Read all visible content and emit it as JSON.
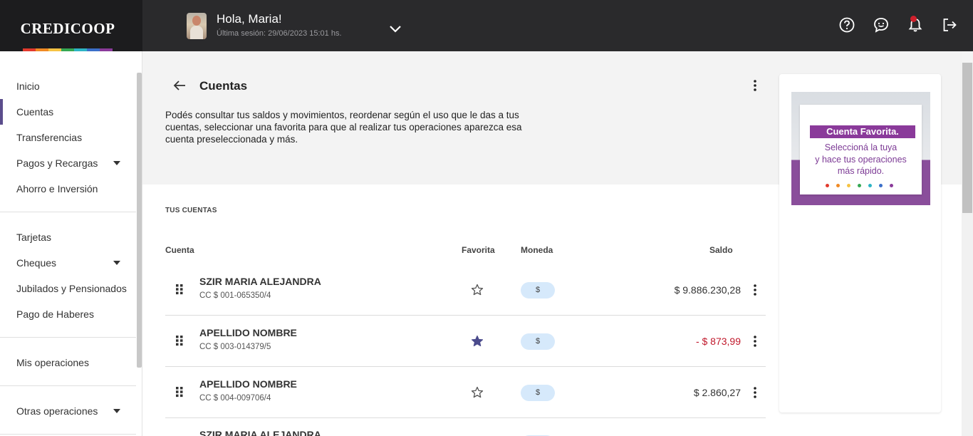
{
  "brand": {
    "name": "CREDICOOP",
    "stripe_colors": [
      "#e23a2d",
      "#f08a24",
      "#f6c343",
      "#35a853",
      "#2db4c5",
      "#3b6fc9",
      "#8a3a9a"
    ]
  },
  "user": {
    "greeting": "Hola, Maria!",
    "last_session": "Última sesión: 29/06/2023 15:01 hs."
  },
  "top_icons": [
    "help-icon",
    "chat-icon",
    "bell-icon",
    "logout-icon"
  ],
  "sidebar": {
    "items": [
      {
        "label": "Inicio"
      },
      {
        "label": "Cuentas",
        "active": true
      },
      {
        "label": "Transferencias"
      },
      {
        "label": "Pagos y Recargas",
        "expandable": true
      },
      {
        "label": "Ahorro e Inversión"
      },
      {
        "label": "Tarjetas"
      },
      {
        "label": "Cheques",
        "expandable": true
      },
      {
        "label": "Jubilados y Pensionados"
      },
      {
        "label": "Pago de Haberes"
      },
      {
        "label": "Mis operaciones"
      },
      {
        "label": "Otras operaciones",
        "expandable": true
      }
    ]
  },
  "page": {
    "title": "Cuentas",
    "description": "Podés consultar tus saldos y movimientos, reordenar según el uso que le das a tus cuentas, seleccionar una favorita para que al realizar tus operaciones aparezca esa cuenta preseleccionada y más."
  },
  "accounts": {
    "section_title": "TUS CUENTAS",
    "headers": {
      "account": "Cuenta",
      "favorite": "Favorita",
      "currency": "Moneda",
      "balance": "Saldo"
    },
    "rows": [
      {
        "name": "SZIR MARIA ALEJANDRA",
        "number": "CC $ 001-065350/4",
        "favorite": false,
        "currency": "$",
        "balance": "$ 9.886.230,28",
        "negative": false
      },
      {
        "name": "APELLIDO NOMBRE",
        "number": "CC $ 003-014379/5",
        "favorite": true,
        "currency": "$",
        "balance": "- $ 873,99",
        "negative": true
      },
      {
        "name": "APELLIDO NOMBRE",
        "number": "CC $ 004-009706/4",
        "favorite": false,
        "currency": "$",
        "balance": "$ 2.860,27",
        "negative": false
      },
      {
        "name": "SZIR MARIA ALEJANDRA",
        "number": "",
        "favorite": false,
        "currency": "$",
        "balance": "",
        "negative": false
      }
    ]
  },
  "promo": {
    "tag": "Cuenta Favorita.",
    "line1": "Seleccioná la tuya",
    "line2": "y hace tus operaciones",
    "line3": "más rápido."
  },
  "colors": {
    "accent": "#5b4d8c",
    "negative": "#c0182b",
    "currency_pill": "#d6e9fb",
    "promo_purple": "#8a3a9a"
  }
}
